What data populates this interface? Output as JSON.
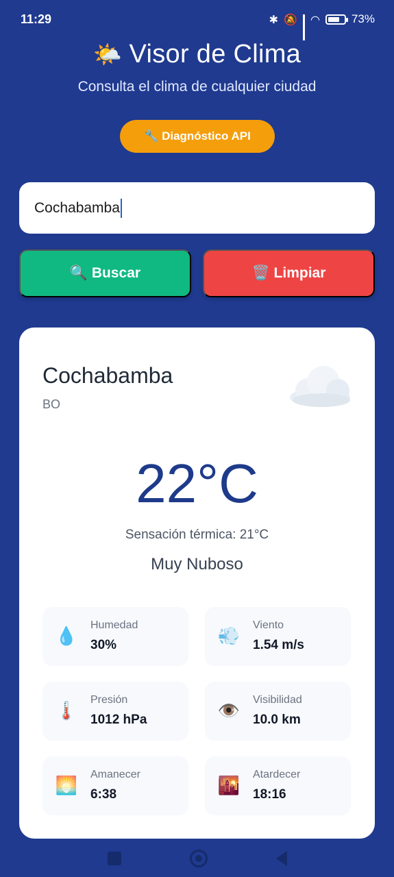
{
  "status_bar": {
    "time": "11:29",
    "battery": "73%",
    "icons": [
      "bluetooth-icon",
      "mute-icon",
      "signal-icon",
      "wifi-icon",
      "battery-icon"
    ]
  },
  "header": {
    "title_icon": "🌤️",
    "title": "Visor de Clima",
    "subtitle": "Consulta el clima de cualquier ciudad",
    "diagnostic_label": "🔧 Diagnóstico API"
  },
  "search": {
    "value": "Cochabamba",
    "search_label": "🔍 Buscar",
    "clear_label": "🗑️ Limpiar"
  },
  "weather": {
    "city": "Cochabamba",
    "country": "BO",
    "icon": "cloud-icon",
    "temperature": "22°C",
    "feels_like": "Sensación térmica: 21°C",
    "condition": "Muy Nuboso",
    "details": [
      {
        "icon": "💧",
        "icon_name": "droplet-icon",
        "label": "Humedad",
        "value": "30%"
      },
      {
        "icon": "💨",
        "icon_name": "wind-icon",
        "label": "Viento",
        "value": "1.54 m/s"
      },
      {
        "icon": "🌡️",
        "icon_name": "thermometer-icon",
        "label": "Presión",
        "value": "1012 hPa"
      },
      {
        "icon": "👁️",
        "icon_name": "eye-icon",
        "label": "Visibilidad",
        "value": "10.0 km"
      },
      {
        "icon": "🌅",
        "icon_name": "sunrise-icon",
        "label": "Amanecer",
        "value": "6:38"
      },
      {
        "icon": "🌇",
        "icon_name": "sunset-icon",
        "label": "Atardecer",
        "value": "18:16"
      }
    ]
  },
  "colors": {
    "background": "#1f3a8f",
    "diagnostic": "#f59e0b",
    "search_button": "#10b981",
    "clear_button": "#ef4444",
    "temperature": "#1e3a8a"
  }
}
